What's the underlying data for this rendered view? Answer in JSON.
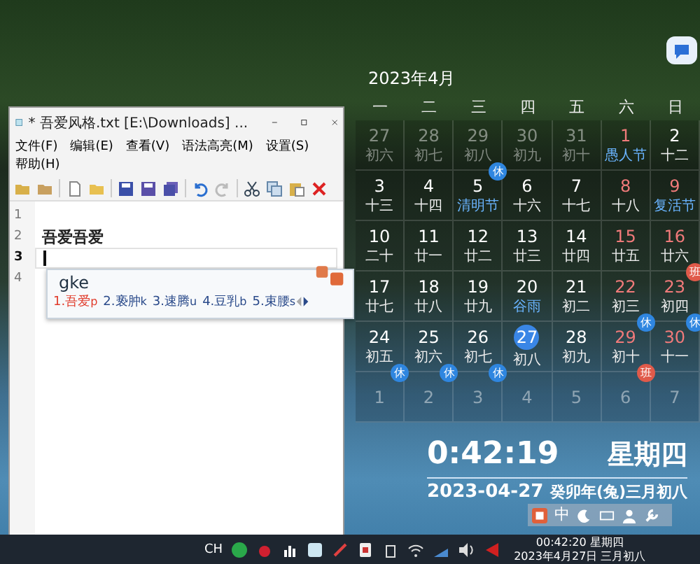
{
  "editor": {
    "title": "* 吾爱风格.txt [E:\\Downloads] ...",
    "menu": [
      "文件(F)",
      "编辑(E)",
      "查看(V)",
      "语法高亮(M)",
      "设置(S)",
      "帮助(H)"
    ],
    "lines": [
      {
        "number": "1",
        "current": false
      },
      {
        "number": "2",
        "text": "吾爱吾爱",
        "current": false
      },
      {
        "number": "3",
        "current": true
      },
      {
        "number": "4",
        "current": false
      }
    ]
  },
  "ime": {
    "composition": "gke",
    "candidates": [
      {
        "label": "1.",
        "text": "吾爱",
        "code": "p",
        "selected": true
      },
      {
        "label": "2.",
        "text": "亵肿",
        "code": "k",
        "selected": false
      },
      {
        "label": "3.",
        "text": "速腾",
        "code": "u",
        "selected": false
      },
      {
        "label": "4.",
        "text": "豆乳",
        "code": "b",
        "selected": false
      },
      {
        "label": "5.",
        "text": "束腰",
        "code": "s",
        "selected": false
      }
    ]
  },
  "calendar": {
    "title": "2023年4月",
    "weekdays": [
      "一",
      "二",
      "三",
      "四",
      "五",
      "六",
      "日"
    ],
    "weeks": [
      [
        {
          "day": "27",
          "lunar": "初六",
          "muted": true,
          "red": false
        },
        {
          "day": "28",
          "lunar": "初七",
          "muted": true,
          "red": false
        },
        {
          "day": "29",
          "lunar": "初八",
          "muted": true,
          "red": false
        },
        {
          "day": "30",
          "lunar": "初九",
          "muted": true,
          "red": false
        },
        {
          "day": "31",
          "lunar": "初十",
          "muted": true,
          "red": false
        },
        {
          "day": "1",
          "lunar": "愚人节",
          "festival": true,
          "muted": false,
          "red": true
        },
        {
          "day": "2",
          "lunar": "十二",
          "muted": false,
          "red": false
        }
      ],
      [
        {
          "day": "3",
          "lunar": "十三",
          "muted": false,
          "red": false
        },
        {
          "day": "4",
          "lunar": "十四",
          "muted": false,
          "red": false
        },
        {
          "day": "5",
          "lunar": "清明节",
          "festival": true,
          "muted": false,
          "red": false,
          "badge": {
            "text": "休",
            "kind": "rest"
          }
        },
        {
          "day": "6",
          "lunar": "十六",
          "muted": false,
          "red": false
        },
        {
          "day": "7",
          "lunar": "十七",
          "muted": false,
          "red": false
        },
        {
          "day": "8",
          "lunar": "十八",
          "muted": false,
          "red": true
        },
        {
          "day": "9",
          "lunar": "复活节",
          "festival": true,
          "muted": false,
          "red": true
        }
      ],
      [
        {
          "day": "10",
          "lunar": "二十",
          "muted": false,
          "red": false
        },
        {
          "day": "11",
          "lunar": "廿一",
          "muted": false,
          "red": false
        },
        {
          "day": "12",
          "lunar": "廿二",
          "muted": false,
          "red": false
        },
        {
          "day": "13",
          "lunar": "廿三",
          "muted": false,
          "red": false
        },
        {
          "day": "14",
          "lunar": "廿四",
          "muted": false,
          "red": false
        },
        {
          "day": "15",
          "lunar": "廿五",
          "muted": false,
          "red": true
        },
        {
          "day": "16",
          "lunar": "廿六",
          "muted": false,
          "red": true
        }
      ],
      [
        {
          "day": "17",
          "lunar": "廿七",
          "muted": false,
          "red": false
        },
        {
          "day": "18",
          "lunar": "廿八",
          "muted": false,
          "red": false
        },
        {
          "day": "19",
          "lunar": "廿九",
          "muted": false,
          "red": false
        },
        {
          "day": "20",
          "lunar": "谷雨",
          "festival": true,
          "muted": false,
          "red": false
        },
        {
          "day": "21",
          "lunar": "初二",
          "muted": false,
          "red": false
        },
        {
          "day": "22",
          "lunar": "初三",
          "muted": false,
          "red": true
        },
        {
          "day": "23",
          "lunar": "初四",
          "muted": false,
          "red": true,
          "badge": {
            "text": "班",
            "kind": "work"
          }
        }
      ],
      [
        {
          "day": "24",
          "lunar": "初五",
          "muted": false,
          "red": false
        },
        {
          "day": "25",
          "lunar": "初六",
          "muted": false,
          "red": false
        },
        {
          "day": "26",
          "lunar": "初七",
          "muted": false,
          "red": false
        },
        {
          "day": "27",
          "lunar": "初八",
          "muted": false,
          "red": false,
          "today": true
        },
        {
          "day": "28",
          "lunar": "初九",
          "muted": false,
          "red": false
        },
        {
          "day": "29",
          "lunar": "初十",
          "muted": false,
          "red": true,
          "badge": {
            "text": "休",
            "kind": "rest"
          }
        },
        {
          "day": "30",
          "lunar": "十一",
          "muted": false,
          "red": true,
          "badge": {
            "text": "休",
            "kind": "rest"
          }
        }
      ],
      [
        {
          "day": "1",
          "muted": true,
          "red": false,
          "badge": {
            "text": "休",
            "kind": "rest"
          }
        },
        {
          "day": "2",
          "muted": true,
          "red": false,
          "badge": {
            "text": "休",
            "kind": "rest"
          }
        },
        {
          "day": "3",
          "muted": true,
          "red": false,
          "badge": {
            "text": "休",
            "kind": "rest"
          }
        },
        {
          "day": "4",
          "muted": true,
          "red": false
        },
        {
          "day": "5",
          "muted": true,
          "red": false
        },
        {
          "day": "6",
          "muted": true,
          "red": false,
          "badge": {
            "text": "班",
            "kind": "work"
          }
        },
        {
          "day": "7",
          "muted": true,
          "red": false
        }
      ]
    ]
  },
  "clock": {
    "time": "0:42:19",
    "weekday": "星期四",
    "date": "2023-04-27",
    "lunar_date": "癸卯年(兔)三月初八"
  },
  "ime_status": {
    "mode": "中"
  },
  "taskbar": {
    "language": "CH",
    "time": "00:42:20 星期四",
    "date": "2023年4月27日 三月初八"
  }
}
